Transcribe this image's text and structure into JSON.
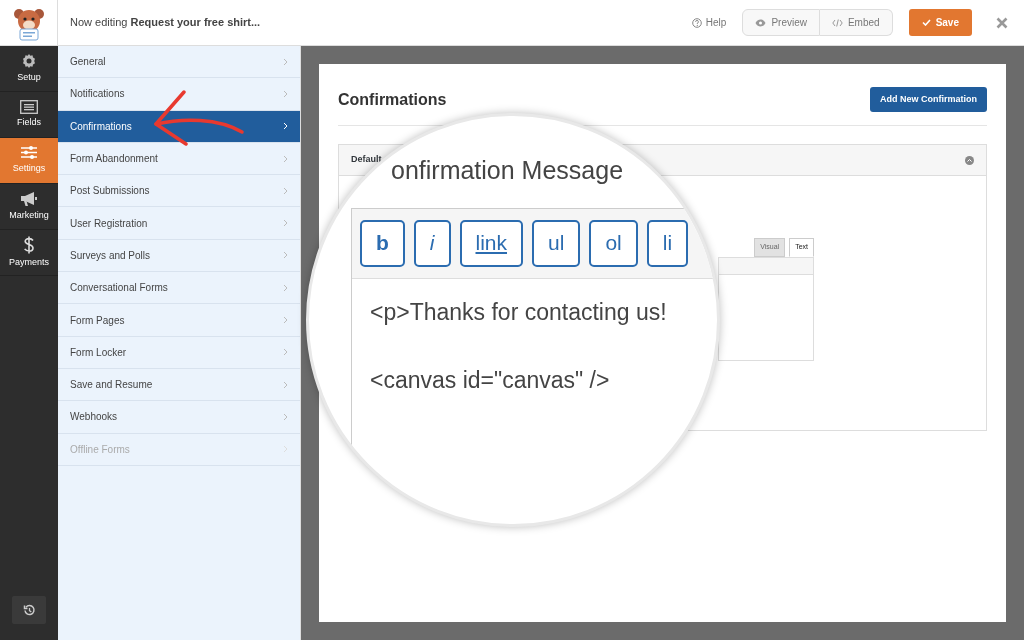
{
  "header": {
    "title_prefix": "Now editing",
    "form_name": "Request your free shirt...",
    "help": "Help",
    "preview": "Preview",
    "embed": "Embed",
    "save": "Save"
  },
  "rail": [
    {
      "label": "Setup",
      "kind": "gear",
      "selected": false
    },
    {
      "label": "Fields",
      "kind": "fields",
      "selected": false
    },
    {
      "label": "Settings",
      "kind": "sliders",
      "selected": true
    },
    {
      "label": "Marketing",
      "kind": "megaphone",
      "selected": false
    },
    {
      "label": "Payments",
      "kind": "dollar",
      "selected": false
    }
  ],
  "settings_menu": [
    {
      "label": "General",
      "selected": false,
      "disabled": false
    },
    {
      "label": "Notifications",
      "selected": false,
      "disabled": false
    },
    {
      "label": "Confirmations",
      "selected": true,
      "disabled": false
    },
    {
      "label": "Form Abandonment",
      "selected": false,
      "disabled": false
    },
    {
      "label": "Post Submissions",
      "selected": false,
      "disabled": false
    },
    {
      "label": "User Registration",
      "selected": false,
      "disabled": false
    },
    {
      "label": "Surveys and Polls",
      "selected": false,
      "disabled": false
    },
    {
      "label": "Conversational Forms",
      "selected": false,
      "disabled": false
    },
    {
      "label": "Form Pages",
      "selected": false,
      "disabled": false
    },
    {
      "label": "Form Locker",
      "selected": false,
      "disabled": false
    },
    {
      "label": "Save and Resume",
      "selected": false,
      "disabled": false
    },
    {
      "label": "Webhooks",
      "selected": false,
      "disabled": false
    },
    {
      "label": "Offline Forms",
      "selected": false,
      "disabled": true
    }
  ],
  "panel": {
    "title": "Confirmations",
    "add_button": "Add New Confirmation",
    "section_title": "Default",
    "editor_tabs": [
      {
        "label": "Visual",
        "selected": false
      },
      {
        "label": "Text",
        "selected": true
      }
    ]
  },
  "magnifier": {
    "heading": "onfirmation Message",
    "toolbar": [
      {
        "label": "b",
        "kind": "bold"
      },
      {
        "label": "i",
        "kind": "italic"
      },
      {
        "label": "link",
        "kind": "link"
      },
      {
        "label": "ul",
        "kind": "plain"
      },
      {
        "label": "ol",
        "kind": "plain"
      },
      {
        "label": "li",
        "kind": "plain"
      }
    ],
    "lines": [
      "<p>Thanks for contacting us!",
      "<canvas id=\"canvas\" />"
    ]
  }
}
